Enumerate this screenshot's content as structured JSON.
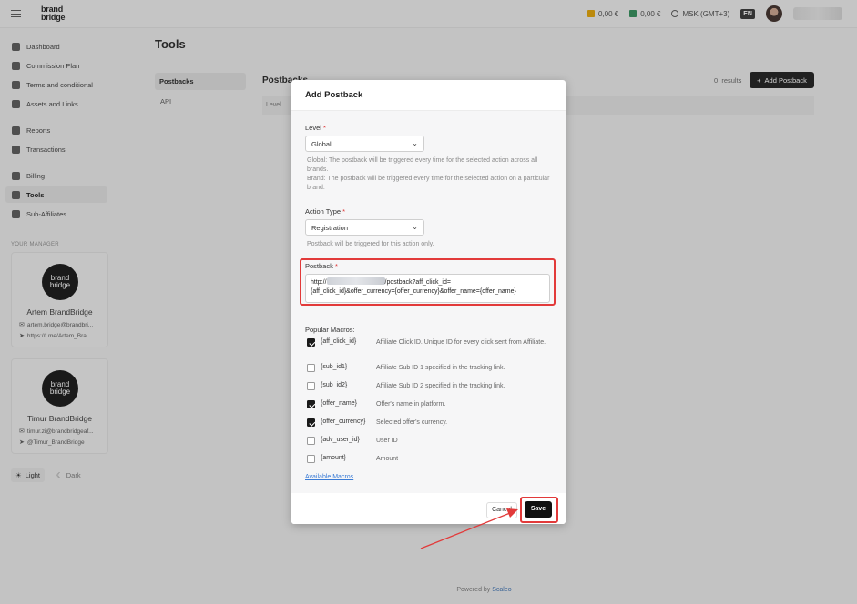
{
  "header": {
    "logo_line1": "brand",
    "logo_line2": "bridge",
    "wallet1": "0,00 €",
    "wallet2": "0,00 €",
    "timezone": "MSK (GMT+3)",
    "language": "EN",
    "colors": {
      "wallet1": "#e0a000",
      "wallet2": "#2e8b57"
    }
  },
  "sidebar": {
    "items": [
      {
        "label": "Dashboard",
        "icon": "dashboard-icon"
      },
      {
        "label": "Commission Plan",
        "icon": "tag-icon"
      },
      {
        "label": "Terms and conditional",
        "icon": "document-icon"
      },
      {
        "label": "Assets and Links",
        "icon": "list-icon"
      },
      {
        "label": "Reports",
        "icon": "bar-chart-icon"
      },
      {
        "label": "Transactions",
        "icon": "transfer-icon"
      },
      {
        "label": "Billing",
        "icon": "card-icon"
      },
      {
        "label": "Tools",
        "icon": "wrench-icon"
      },
      {
        "label": "Sub-Affiliates",
        "icon": "users-icon"
      }
    ],
    "section_label": "YOUR MANAGER",
    "managers": [
      {
        "logo1": "brand",
        "logo2": "bridge",
        "name": "Artem BrandBridge",
        "email": "artem.bridge@brandbri...",
        "link": "https://t.me/Artem_Bra..."
      },
      {
        "logo1": "brand",
        "logo2": "bridge",
        "name": "Timur BrandBridge",
        "email": "timur.zi@brandbridgeaf...",
        "link": "@Timur_BrandBridge"
      }
    ],
    "theme_light": "Light",
    "theme_dark": "Dark"
  },
  "page": {
    "title": "Tools",
    "subnav_postbacks": "Postbacks",
    "subnav_api": "API",
    "content_title": "Postbacks",
    "results_count": "0",
    "results_label": "results",
    "add_button": "Add Postback",
    "table_col_level": "Level",
    "footer_prefix": "Powered by",
    "footer_brand": "Scaleo"
  },
  "modal": {
    "title": "Add Postback",
    "level_label": "Level",
    "required_mark": "*",
    "level_value": "Global",
    "level_hint_global": "Global: The postback will be triggered every time for the selected action across all brands.",
    "level_hint_brand": "Brand: The postback will be triggered every time for the selected action on a particular brand.",
    "action_label": "Action Type",
    "action_value": "Registration",
    "action_hint": "Postback will be triggered for this action only.",
    "postback_label": "Postback",
    "postback_prefix": "http://",
    "postback_suffix": "/postback?aff_click_id=",
    "postback_line2": "{aff_click_id}&offer_currency={offer_currency}&offer_name={offer_name}",
    "macros_label": "Popular Macros:",
    "macros": [
      {
        "name": "{aff_click_id}",
        "desc": "Affiliate Click ID. Unique ID for every click sent from Affiliate.",
        "checked": true
      },
      {
        "name": "{sub_id1}",
        "desc": "Affiliate Sub ID 1 specified in the tracking link.",
        "checked": false
      },
      {
        "name": "{sub_id2}",
        "desc": "Affiliate Sub ID 2 specified in the tracking link.",
        "checked": false
      },
      {
        "name": "{offer_name}",
        "desc": "Offer's name in platform.",
        "checked": true
      },
      {
        "name": "{offer_currency}",
        "desc": "Selected offer's currency.",
        "checked": true
      },
      {
        "name": "{adv_user_id}",
        "desc": "User ID",
        "checked": false
      },
      {
        "name": "{amount}",
        "desc": "Amount",
        "checked": false
      }
    ],
    "available_macros": "Available Macros",
    "cancel": "Cancel",
    "save": "Save",
    "highlight_color": "#e23a3a"
  }
}
